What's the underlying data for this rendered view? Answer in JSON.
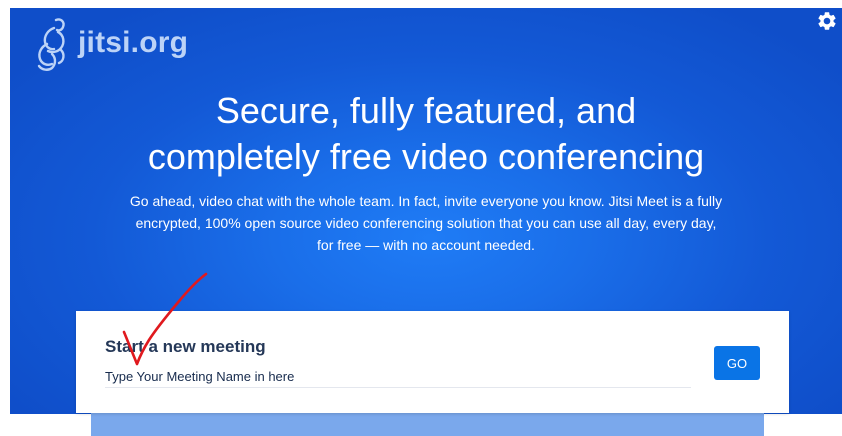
{
  "brand": {
    "logo_text": "jitsi.org"
  },
  "icons": {
    "logo": "jitsi-logo-icon",
    "settings": "gear-icon",
    "annotation": "red-checkmark-icon"
  },
  "hero": {
    "title_line1": "Secure, fully featured, and",
    "title_line2": "completely free video conferencing",
    "desc_line1": "Go ahead, video chat with the whole team. In fact, invite everyone you know. Jitsi Meet is a fully",
    "desc_line2": "encrypted, 100% open source video conferencing solution that you can use all day, every day,",
    "desc_line3": "for free — with no account needed."
  },
  "meeting": {
    "heading": "Start a new meeting",
    "input_value": "Type Your Meeting Name in here",
    "go_label": "GO"
  },
  "colors": {
    "hero_blue": "#1a6ee9",
    "button_blue": "#0a74e6",
    "heading_navy": "#253858",
    "annotation_red": "#e0191e"
  }
}
